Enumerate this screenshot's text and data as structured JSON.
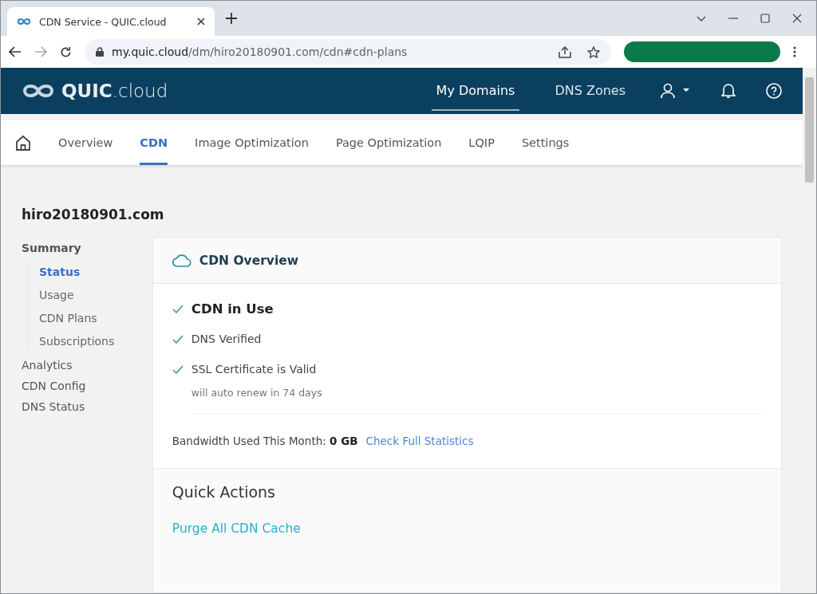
{
  "browser": {
    "tab_title": "CDN Service - QUIC.cloud",
    "url_host": "my.quic.cloud",
    "url_path": "/dm/hiro20180901.com/cdn#cdn-plans"
  },
  "header": {
    "logo": [
      "QUIC",
      ".cloud"
    ],
    "nav": [
      {
        "label": "My Domains",
        "selected": true
      },
      {
        "label": "DNS Zones",
        "selected": false
      }
    ]
  },
  "tabs": [
    {
      "label": "Overview",
      "selected": false
    },
    {
      "label": "CDN",
      "selected": true
    },
    {
      "label": "Image Optimization",
      "selected": false
    },
    {
      "label": "Page Optimization",
      "selected": false
    },
    {
      "label": "LQIP",
      "selected": false
    },
    {
      "label": "Settings",
      "selected": false
    }
  ],
  "domain": "hiro20180901.com",
  "sidebar": {
    "items": [
      {
        "label": "Summary",
        "selected": false,
        "children": [
          {
            "label": "Status",
            "selected": true
          },
          {
            "label": "Usage",
            "selected": false
          },
          {
            "label": "CDN Plans",
            "selected": false
          },
          {
            "label": "Subscriptions",
            "selected": false
          }
        ]
      },
      {
        "label": "Analytics",
        "selected": false
      },
      {
        "label": "CDN Config",
        "selected": false
      },
      {
        "label": "DNS Status",
        "selected": false
      }
    ]
  },
  "card": {
    "title": "CDN Overview",
    "checks": [
      {
        "kind": "primary",
        "label": "CDN in Use"
      },
      {
        "kind": "normal",
        "label": "DNS Verified"
      },
      {
        "kind": "normal",
        "label": "SSL Certificate is Valid",
        "note": "will auto renew in 74 days"
      }
    ],
    "bandwidth": "Bandwidth Used This Month: **0 GB**",
    "stats_link": "Check Full Statistics",
    "quick_actions": {
      "title": "Quick Actions",
      "actions": [
        "Purge All CDN Cache"
      ]
    }
  }
}
